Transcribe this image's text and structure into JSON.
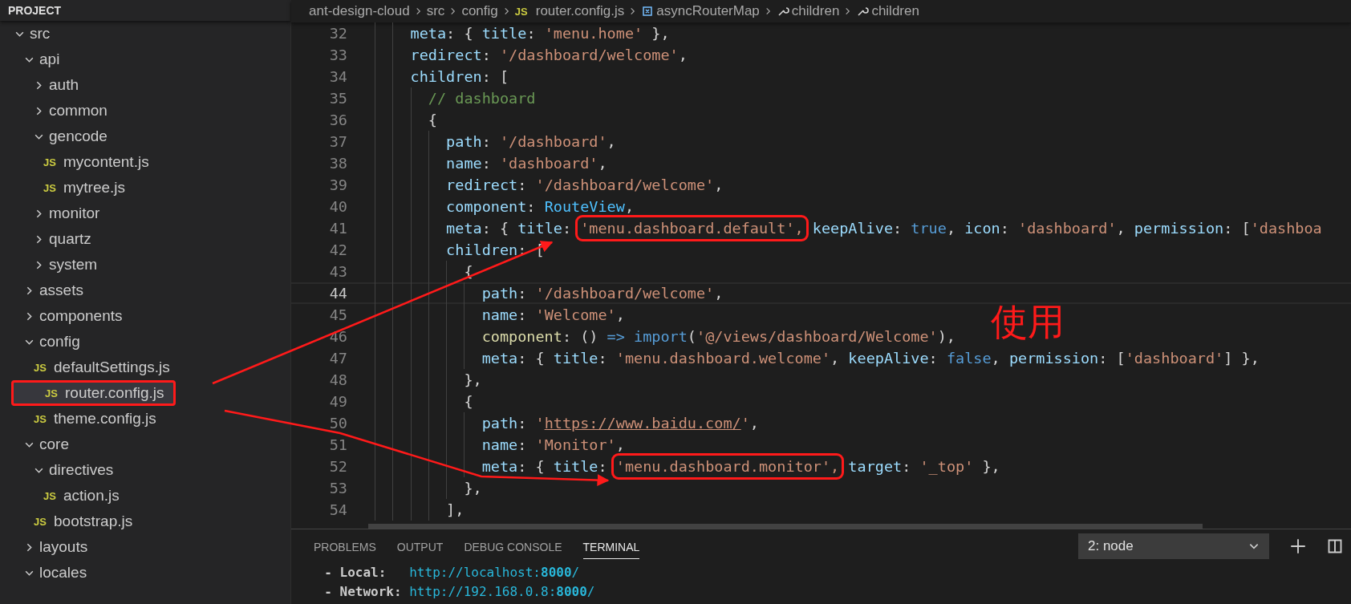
{
  "sidebar": {
    "title": "PROJECT",
    "tree": [
      {
        "label": "src",
        "kind": "folder",
        "expanded": true,
        "selected": false,
        "children": [
          {
            "label": "api",
            "kind": "folder",
            "expanded": true,
            "selected": false,
            "children": [
              {
                "label": "auth",
                "kind": "folder",
                "expanded": false,
                "selected": false
              },
              {
                "label": "common",
                "kind": "folder",
                "expanded": false,
                "selected": false
              },
              {
                "label": "gencode",
                "kind": "folder",
                "expanded": true,
                "selected": false,
                "children": [
                  {
                    "label": "mycontent.js",
                    "kind": "file",
                    "icon_text": "JS",
                    "selected": false
                  },
                  {
                    "label": "mytree.js",
                    "kind": "file",
                    "icon_text": "JS",
                    "selected": false
                  }
                ]
              },
              {
                "label": "monitor",
                "kind": "folder",
                "expanded": false,
                "selected": false
              },
              {
                "label": "quartz",
                "kind": "folder",
                "expanded": false,
                "selected": false
              },
              {
                "label": "system",
                "kind": "folder",
                "expanded": false,
                "selected": false
              }
            ]
          },
          {
            "label": "assets",
            "kind": "folder",
            "expanded": false,
            "selected": false
          },
          {
            "label": "components",
            "kind": "folder",
            "expanded": false,
            "selected": false
          },
          {
            "label": "config",
            "kind": "folder",
            "expanded": true,
            "selected": false,
            "children": [
              {
                "label": "defaultSettings.js",
                "kind": "file",
                "icon_text": "JS",
                "selected": false
              },
              {
                "label": "router.config.js",
                "kind": "file",
                "icon_text": "JS",
                "selected": true,
                "boxed": true
              },
              {
                "label": "theme.config.js",
                "kind": "file",
                "icon_text": "JS",
                "selected": false
              }
            ]
          },
          {
            "label": "core",
            "kind": "folder",
            "expanded": true,
            "selected": false,
            "children": [
              {
                "label": "directives",
                "kind": "folder",
                "expanded": true,
                "selected": false,
                "children": [
                  {
                    "label": "action.js",
                    "kind": "file",
                    "icon_text": "JS",
                    "selected": false
                  }
                ]
              },
              {
                "label": "bootstrap.js",
                "kind": "file",
                "icon_text": "JS",
                "selected": false
              }
            ]
          },
          {
            "label": "layouts",
            "kind": "folder",
            "expanded": false,
            "selected": false
          },
          {
            "label": "locales",
            "kind": "folder",
            "expanded": true,
            "selected": false
          }
        ]
      }
    ]
  },
  "breadcrumb": [
    {
      "label": "ant-design-cloud",
      "kind": "folder"
    },
    {
      "label": "src",
      "kind": "folder"
    },
    {
      "label": "config",
      "kind": "folder"
    },
    {
      "label": "router.config.js",
      "kind": "js-file",
      "icon_text": "JS"
    },
    {
      "label": "asyncRouterMap",
      "kind": "variable"
    },
    {
      "label": "children",
      "kind": "property"
    },
    {
      "label": "children",
      "kind": "property"
    }
  ],
  "editor": {
    "lines": [
      {
        "number": "32",
        "current": false,
        "tokens": [
          {
            "text": "    meta",
            "kind": "key"
          },
          {
            "text": ": { ",
            "kind": "punct"
          },
          {
            "text": "title",
            "kind": "key"
          },
          {
            "text": ": ",
            "kind": "punct"
          },
          {
            "text": "'menu.home'",
            "kind": "string"
          },
          {
            "text": " },",
            "kind": "punct"
          }
        ]
      },
      {
        "number": "33",
        "current": false,
        "tokens": [
          {
            "text": "    redirect",
            "kind": "key"
          },
          {
            "text": ": ",
            "kind": "punct"
          },
          {
            "text": "'/dashboard/welcome'",
            "kind": "string"
          },
          {
            "text": ",",
            "kind": "punct"
          }
        ]
      },
      {
        "number": "34",
        "current": false,
        "tokens": [
          {
            "text": "    children",
            "kind": "key"
          },
          {
            "text": ": [",
            "kind": "punct"
          }
        ]
      },
      {
        "number": "35",
        "current": false,
        "tokens": [
          {
            "text": "      // dashboard",
            "kind": "comment"
          }
        ]
      },
      {
        "number": "36",
        "current": false,
        "tokens": [
          {
            "text": "      {",
            "kind": "punct"
          }
        ]
      },
      {
        "number": "37",
        "current": false,
        "tokens": [
          {
            "text": "        path",
            "kind": "key"
          },
          {
            "text": ": ",
            "kind": "punct"
          },
          {
            "text": "'/dashboard'",
            "kind": "string"
          },
          {
            "text": ",",
            "kind": "punct"
          }
        ]
      },
      {
        "number": "38",
        "current": false,
        "tokens": [
          {
            "text": "        name",
            "kind": "key"
          },
          {
            "text": ": ",
            "kind": "punct"
          },
          {
            "text": "'dashboard'",
            "kind": "string"
          },
          {
            "text": ",",
            "kind": "punct"
          }
        ]
      },
      {
        "number": "39",
        "current": false,
        "tokens": [
          {
            "text": "        redirect",
            "kind": "key"
          },
          {
            "text": ": ",
            "kind": "punct"
          },
          {
            "text": "'/dashboard/welcome'",
            "kind": "string"
          },
          {
            "text": ",",
            "kind": "punct"
          }
        ]
      },
      {
        "number": "40",
        "current": false,
        "tokens": [
          {
            "text": "        component",
            "kind": "key"
          },
          {
            "text": ": ",
            "kind": "punct"
          },
          {
            "text": "RouteView",
            "kind": "constant"
          },
          {
            "text": ",",
            "kind": "punct"
          }
        ]
      },
      {
        "number": "41",
        "current": false,
        "tokens": [
          {
            "text": "        meta",
            "kind": "key"
          },
          {
            "text": ": { ",
            "kind": "punct"
          },
          {
            "text": "title",
            "kind": "key"
          },
          {
            "text": ": ",
            "kind": "punct"
          },
          {
            "text": "'menu.dashboard.default',",
            "kind": "string",
            "boxed": true
          },
          {
            "text": " keepAlive",
            "kind": "key"
          },
          {
            "text": ": ",
            "kind": "punct"
          },
          {
            "text": "true",
            "kind": "keyword"
          },
          {
            "text": ", ",
            "kind": "punct"
          },
          {
            "text": "icon",
            "kind": "key"
          },
          {
            "text": ": ",
            "kind": "punct"
          },
          {
            "text": "'dashboard'",
            "kind": "string"
          },
          {
            "text": ", ",
            "kind": "punct"
          },
          {
            "text": "permission",
            "kind": "key"
          },
          {
            "text": ": [",
            "kind": "punct"
          },
          {
            "text": "'dashboa",
            "kind": "string"
          }
        ]
      },
      {
        "number": "42",
        "current": false,
        "tokens": [
          {
            "text": "        children",
            "kind": "key"
          },
          {
            "text": ": [",
            "kind": "punct"
          }
        ]
      },
      {
        "number": "43",
        "current": false,
        "tokens": [
          {
            "text": "          {",
            "kind": "punct"
          }
        ]
      },
      {
        "number": "44",
        "current": true,
        "tokens": [
          {
            "text": "            path",
            "kind": "key"
          },
          {
            "text": ": ",
            "kind": "punct"
          },
          {
            "text": "'/dashboard/welcome'",
            "kind": "string"
          },
          {
            "text": ",",
            "kind": "punct"
          }
        ]
      },
      {
        "number": "45",
        "current": false,
        "tokens": [
          {
            "text": "            name",
            "kind": "key"
          },
          {
            "text": ": ",
            "kind": "punct"
          },
          {
            "text": "'Welcome'",
            "kind": "string"
          },
          {
            "text": ",",
            "kind": "punct"
          }
        ]
      },
      {
        "number": "46",
        "current": false,
        "tokens": [
          {
            "text": "            component",
            "kind": "function"
          },
          {
            "text": ": () ",
            "kind": "punct"
          },
          {
            "text": "=>",
            "kind": "keyword"
          },
          {
            "text": " import",
            "kind": "keyword"
          },
          {
            "text": "(",
            "kind": "punct"
          },
          {
            "text": "'@/views/dashboard/Welcome'",
            "kind": "string"
          },
          {
            "text": "),",
            "kind": "punct"
          }
        ]
      },
      {
        "number": "47",
        "current": false,
        "tokens": [
          {
            "text": "            meta",
            "kind": "key"
          },
          {
            "text": ": { ",
            "kind": "punct"
          },
          {
            "text": "title",
            "kind": "key"
          },
          {
            "text": ": ",
            "kind": "punct"
          },
          {
            "text": "'menu.dashboard.welcome'",
            "kind": "string"
          },
          {
            "text": ", ",
            "kind": "punct"
          },
          {
            "text": "keepAlive",
            "kind": "key"
          },
          {
            "text": ": ",
            "kind": "punct"
          },
          {
            "text": "false",
            "kind": "keyword"
          },
          {
            "text": ", ",
            "kind": "punct"
          },
          {
            "text": "permission",
            "kind": "key"
          },
          {
            "text": ": [",
            "kind": "punct"
          },
          {
            "text": "'dashboard'",
            "kind": "string"
          },
          {
            "text": "] },",
            "kind": "punct"
          }
        ]
      },
      {
        "number": "48",
        "current": false,
        "tokens": [
          {
            "text": "          },",
            "kind": "punct"
          }
        ]
      },
      {
        "number": "49",
        "current": false,
        "tokens": [
          {
            "text": "          {",
            "kind": "punct"
          }
        ]
      },
      {
        "number": "50",
        "current": false,
        "tokens": [
          {
            "text": "            path",
            "kind": "key"
          },
          {
            "text": ": ",
            "kind": "punct"
          },
          {
            "text": "'",
            "kind": "string"
          },
          {
            "text": "https://www.baidu.com/",
            "kind": "link"
          },
          {
            "text": "'",
            "kind": "string"
          },
          {
            "text": ",",
            "kind": "punct"
          }
        ]
      },
      {
        "number": "51",
        "current": false,
        "tokens": [
          {
            "text": "            name",
            "kind": "key"
          },
          {
            "text": ": ",
            "kind": "punct"
          },
          {
            "text": "'Monitor'",
            "kind": "string"
          },
          {
            "text": ",",
            "kind": "punct"
          }
        ]
      },
      {
        "number": "52",
        "current": false,
        "tokens": [
          {
            "text": "            meta",
            "kind": "key"
          },
          {
            "text": ": { ",
            "kind": "punct"
          },
          {
            "text": "title",
            "kind": "key"
          },
          {
            "text": ": ",
            "kind": "punct"
          },
          {
            "text": "'menu.dashboard.monitor',",
            "kind": "string",
            "boxed": true
          },
          {
            "text": " target",
            "kind": "key"
          },
          {
            "text": ": ",
            "kind": "punct"
          },
          {
            "text": "'_top'",
            "kind": "string"
          },
          {
            "text": " },",
            "kind": "punct"
          }
        ]
      },
      {
        "number": "53",
        "current": false,
        "tokens": [
          {
            "text": "          },",
            "kind": "punct"
          }
        ]
      },
      {
        "number": "54",
        "current": false,
        "tokens": [
          {
            "text": "        ],",
            "kind": "punct"
          }
        ]
      }
    ]
  },
  "annotation_text": "使用",
  "panel": {
    "tabs": [
      {
        "label": "PROBLEMS",
        "selected": false
      },
      {
        "label": "OUTPUT",
        "selected": false
      },
      {
        "label": "DEBUG CONSOLE",
        "selected": false
      },
      {
        "label": "TERMINAL",
        "selected": true
      }
    ],
    "terminal_select": "2: node",
    "terminal_lines": [
      [
        {
          "text": "  - Local:   ",
          "kind": "label"
        },
        {
          "text": "http://localhost:",
          "kind": "url"
        },
        {
          "text": "8000",
          "kind": "url-bold"
        },
        {
          "text": "/",
          "kind": "url"
        }
      ],
      [
        {
          "text": "  - Network: ",
          "kind": "label"
        },
        {
          "text": "http://192.168.0.8:",
          "kind": "url"
        },
        {
          "text": "8000",
          "kind": "url-bold"
        },
        {
          "text": "/",
          "kind": "url"
        }
      ]
    ]
  }
}
